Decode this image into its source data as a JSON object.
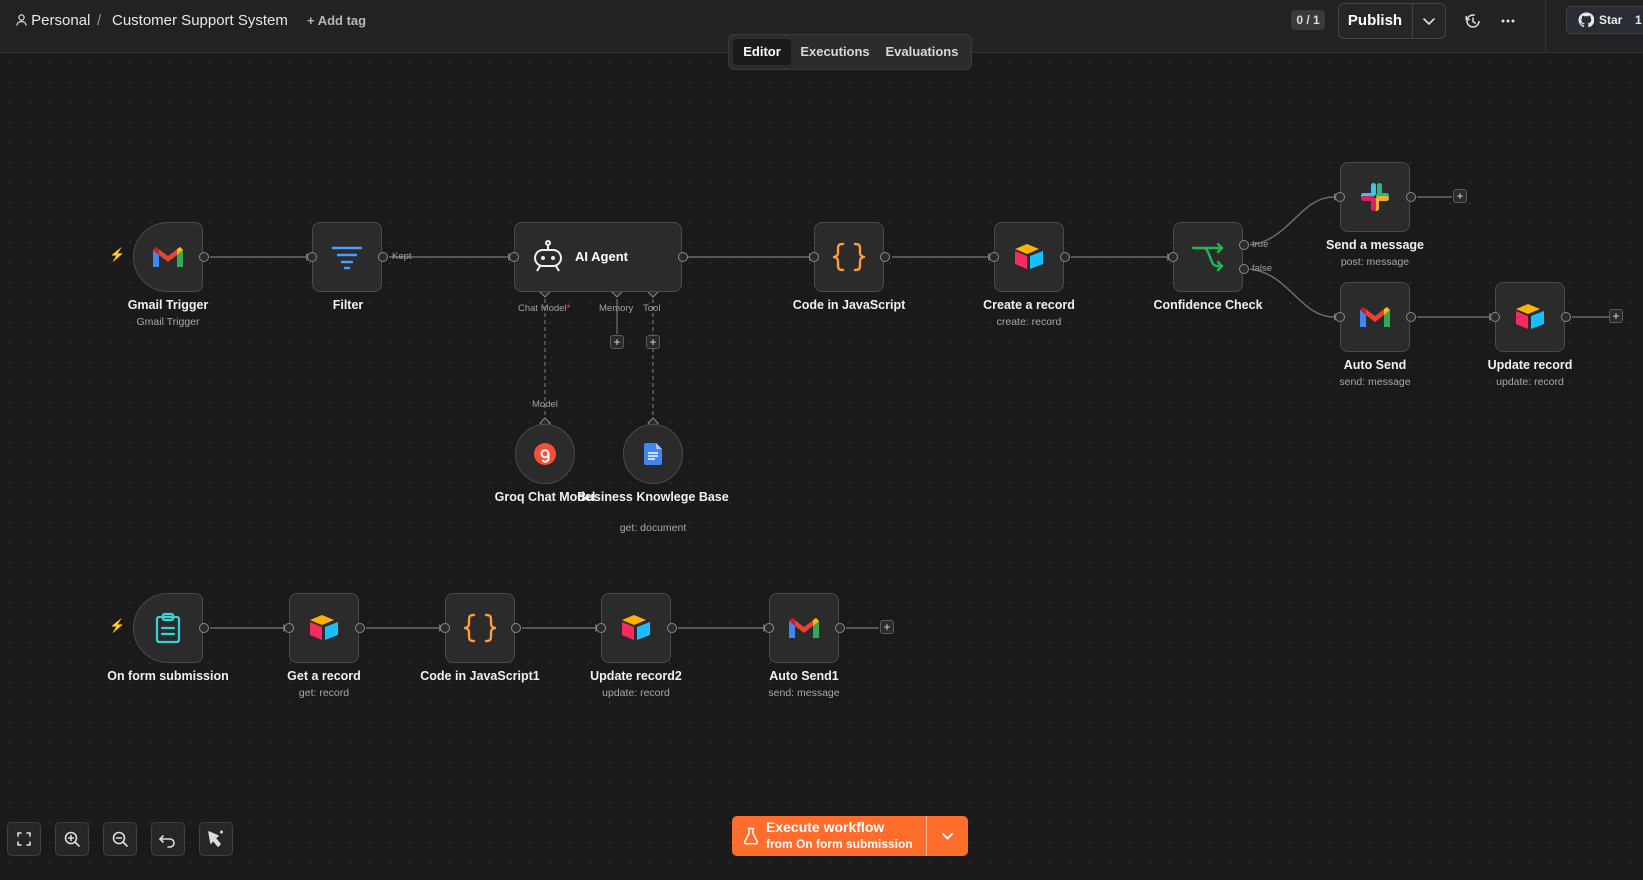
{
  "header": {
    "project": "Personal",
    "separator": "/",
    "workflow_name": "Customer Support System",
    "add_tag": "+ Add tag",
    "counter": "0 / 1",
    "publish_label": "Publish",
    "star_label": "Star",
    "star_count": "1"
  },
  "tabs": [
    {
      "label": "Editor",
      "active": true
    },
    {
      "label": "Executions",
      "active": false
    },
    {
      "label": "Evaluations",
      "active": false
    }
  ],
  "nodes": {
    "gmail_trigger": {
      "label": "Gmail Trigger",
      "sub": "Gmail Trigger"
    },
    "filter": {
      "label": "Filter"
    },
    "ai_agent": {
      "label": "AI Agent"
    },
    "code_js": {
      "label": "Code in JavaScript"
    },
    "create_record": {
      "label": "Create a record",
      "sub": "create: record"
    },
    "confidence": {
      "label": "Confidence Check"
    },
    "send_message": {
      "label": "Send a message",
      "sub": "post: message"
    },
    "auto_send": {
      "label": "Auto Send",
      "sub": "send: message"
    },
    "update_record": {
      "label": "Update record",
      "sub": "update: record"
    },
    "groq": {
      "label": "Groq Chat Model"
    },
    "knowledge": {
      "label": "Business Knowlege Base",
      "sub": "get: document"
    },
    "form": {
      "label": "On form submission"
    },
    "get_record": {
      "label": "Get a record",
      "sub": "get: record"
    },
    "code_js1": {
      "label": "Code in JavaScript1"
    },
    "update_record2": {
      "label": "Update record2",
      "sub": "update: record"
    },
    "auto_send1": {
      "label": "Auto Send1",
      "sub": "send: message"
    }
  },
  "edge_labels": {
    "kept": "Kept",
    "true": "true",
    "false": "false",
    "chat_model": "Chat Model",
    "required_mark": "*",
    "memory": "Memory",
    "tool": "Tool",
    "model": "Model"
  },
  "execute": {
    "label": "Execute workflow",
    "sub": "from On form submission"
  },
  "colors": {
    "accent": "#ff6d2d",
    "canvas": "#1a1a1a",
    "node_bg": "#2b2b2b"
  },
  "icons": [
    "user-icon",
    "history-icon",
    "more-icon",
    "github-icon",
    "gmail-icon",
    "filter-icon",
    "robot-icon",
    "code-braces-icon",
    "airtable-icon",
    "branch-icon",
    "slack-icon",
    "groq-icon",
    "google-docs-icon",
    "form-icon",
    "fit-view-icon",
    "zoom-in-icon",
    "zoom-out-icon",
    "undo-icon",
    "tidy-icon",
    "flask-icon",
    "chevron-down-icon",
    "bolt-icon"
  ]
}
